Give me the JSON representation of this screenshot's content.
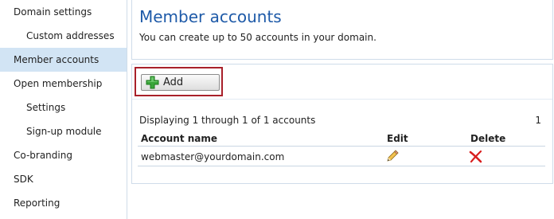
{
  "sidebar": {
    "items": [
      {
        "label": "Domain settings"
      },
      {
        "label": "Custom addresses"
      },
      {
        "label": "Member accounts"
      },
      {
        "label": "Open membership"
      },
      {
        "label": "Settings"
      },
      {
        "label": "Sign-up module"
      },
      {
        "label": "Co-branding"
      },
      {
        "label": "SDK"
      },
      {
        "label": "Reporting"
      }
    ],
    "active": "Member accounts"
  },
  "header": {
    "title": "Member accounts",
    "subtitle": "You can create up to 50 accounts in your domain."
  },
  "toolbar": {
    "add_label": "Add",
    "add_icon": "plus-icon"
  },
  "list": {
    "displaying": "Displaying 1 through 1 of 1 accounts",
    "page": "1",
    "columns": {
      "account": "Account name",
      "edit": "Edit",
      "delete": "Delete"
    },
    "rows": [
      {
        "account": "webmaster@yourdomain.com",
        "edit_icon": "pencil-icon",
        "delete_icon": "delete-x-icon"
      }
    ]
  },
  "colors": {
    "title": "#1e5aa8",
    "active_nav": "#d2e4f4",
    "highlight_border": "#a8202a",
    "plus_green": "#3aa63a",
    "delete_red": "#d81e1e"
  }
}
